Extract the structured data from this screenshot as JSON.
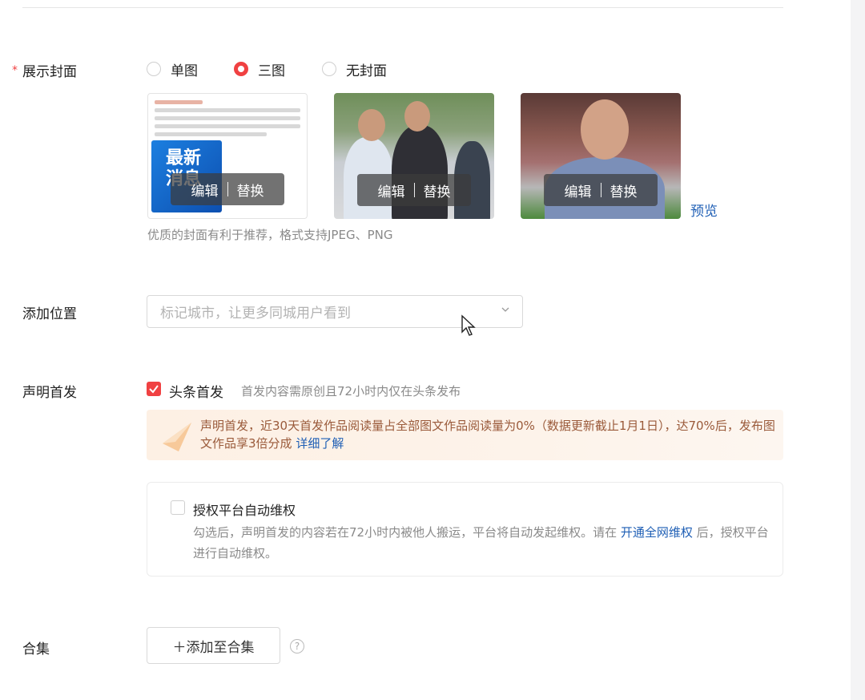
{
  "cover_section": {
    "label": "展示封面",
    "required_mark": "*",
    "options": [
      {
        "label": "单图",
        "checked": false
      },
      {
        "label": "三图",
        "checked": true
      },
      {
        "label": "无封面",
        "checked": false
      }
    ],
    "covers": [
      {
        "edit_label": "编辑",
        "replace_label": "替换",
        "badge_text": "最新 消息"
      },
      {
        "edit_label": "编辑",
        "replace_label": "替换"
      },
      {
        "edit_label": "编辑",
        "replace_label": "替换"
      }
    ],
    "preview_label": "预览",
    "hint": "优质的封面有利于推荐，格式支持JPEG、PNG"
  },
  "location": {
    "label": "添加位置",
    "placeholder": "标记城市，让更多同城用户看到"
  },
  "declaration": {
    "label": "声明首发",
    "checkbox_label": "头条首发",
    "checkbox_checked": true,
    "checkbox_desc": "首发内容需原创且72小时内仅在头条发布",
    "notice_text": "声明首发，近30天首发作品阅读量占全部图文作品阅读量为0%（数据更新截止1月1日），达70%后，发布图文作品享3倍分成",
    "notice_link": "详细了解",
    "auth": {
      "title": "授权平台自动维权",
      "checked": false,
      "desc_before": "勾选后，声明首发的内容若在72小时内被他人搬运，平台将自动发起维权。请在",
      "desc_link": "开通全网维权",
      "desc_after": "后，授权平台进行自动维权。"
    }
  },
  "collection": {
    "label": "合集",
    "add_button": "＋添加至合集",
    "help_icon": "?"
  },
  "colors": {
    "accent_red": "#f04142",
    "link_blue": "#1f5fb5"
  }
}
